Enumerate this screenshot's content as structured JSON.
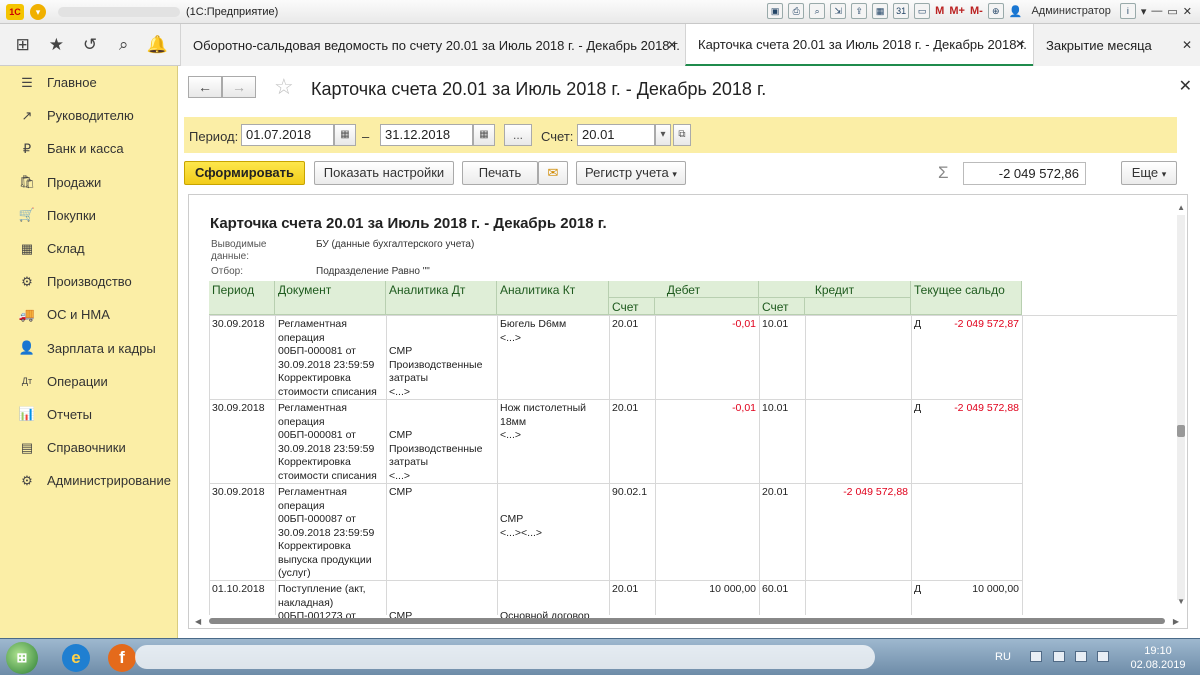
{
  "titlebar": {
    "logo": "1С",
    "title": "(1С:Предприятие)",
    "m1": "M",
    "m2": "M+",
    "m3": "M-",
    "calendar_day": "31",
    "user": "Администратор"
  },
  "tabs": [
    {
      "label": "Оборотно-сальдовая ведомость по счету 20.01 за Июль 2018 г. - Декабрь 2018 г."
    },
    {
      "label": "Карточка счета 20.01 за Июль 2018 г. - Декабрь 2018 г."
    },
    {
      "label": "Закрытие месяца"
    }
  ],
  "sidebar": {
    "items": [
      {
        "label": "Главное",
        "icon": "☰"
      },
      {
        "label": "Руководителю",
        "icon": "↗"
      },
      {
        "label": "Банк и касса",
        "icon": "₽"
      },
      {
        "label": "Продажи",
        "icon": "🛍"
      },
      {
        "label": "Покупки",
        "icon": "🛒"
      },
      {
        "label": "Склад",
        "icon": "▦"
      },
      {
        "label": "Производство",
        "icon": "⚙"
      },
      {
        "label": "ОС и НМА",
        "icon": "🚚"
      },
      {
        "label": "Зарплата и кадры",
        "icon": "👤"
      },
      {
        "label": "Операции",
        "icon": "Дт"
      },
      {
        "label": "Отчеты",
        "icon": "📊"
      },
      {
        "label": "Справочники",
        "icon": "▤"
      },
      {
        "label": "Администрирование",
        "icon": "⚙"
      }
    ]
  },
  "page": {
    "title": "Карточка счета 20.01 за Июль 2018 г. - Декабрь 2018 г."
  },
  "filters": {
    "period_label": "Период:",
    "date_from": "01.07.2018",
    "dash": "–",
    "date_to": "31.12.2018",
    "ellipsis": "...",
    "account_label": "Счет:",
    "account": "20.01"
  },
  "toolbar": {
    "generate": "Сформировать",
    "show_settings": "Показать настройки",
    "print": "Печать",
    "register": "Регистр учета",
    "sum": "-2 049 572,86",
    "more": "Еще"
  },
  "report": {
    "title": "Карточка счета 20.01 за Июль 2018 г. - Декабрь 2018 г.",
    "output_label": "Выводимые данные:",
    "output_value": "БУ (данные бухгалтерского учета)",
    "filter_label": "Отбор:",
    "filter_value": "Подразделение Равно \"\"",
    "headers": {
      "period": "Период",
      "document": "Документ",
      "analytics_dt": "Аналитика Дт",
      "analytics_kt": "Аналитика Кт",
      "debit": "Дебет",
      "credit": "Кредит",
      "balance": "Текущее сальдо",
      "account_dt": "Счет",
      "account_kt": "Счет"
    },
    "rows": [
      {
        "period": "30.09.2018",
        "document": "Регламентная\nоперация\n00БП-000081 от\n30.09.2018 23:59:59\nКорректировка\nстоимости списания",
        "analytics_dt": "\n\nСМР\nПроизводственные\nзатраты\n<...>",
        "analytics_kt": "Бюгель D6мм\n<...>",
        "account_dt": "20.01",
        "debit": "-0,01",
        "account_kt": "10.01",
        "credit": "",
        "balance_side": "Д",
        "balance": "-2 049 572,87"
      },
      {
        "period": "30.09.2018",
        "document": "Регламентная\nоперация\n00БП-000081 от\n30.09.2018 23:59:59\nКорректировка\nстоимости списания",
        "analytics_dt": "\n\nСМР\nПроизводственные\nзатраты\n<...>",
        "analytics_kt": "Нож пистолетный\n18мм\n<...>",
        "account_dt": "20.01",
        "debit": "-0,01",
        "account_kt": "10.01",
        "credit": "",
        "balance_side": "Д",
        "balance": "-2 049 572,88"
      },
      {
        "period": "30.09.2018",
        "document": "Регламентная\nоперация\n00БП-000087 от\n30.09.2018 23:59:59\nКорректировка\nвыпуска продукции\n(услуг)",
        "analytics_dt": "СМР",
        "analytics_kt": "\n\nСМР\n<...><...>",
        "account_dt": "90.02.1",
        "debit": "",
        "account_kt": "20.01",
        "credit": "-2 049 572,88",
        "balance_side": "",
        "balance": ""
      },
      {
        "period": "01.10.2018",
        "document": "Поступление (акт,\nнакладная)\n00БП-001273 от",
        "analytics_dt": "\n\nСМР",
        "analytics_kt": "\n\nОсновной договор",
        "account_dt": "20.01",
        "debit": "10 000,00",
        "account_kt": "60.01",
        "credit": "",
        "balance_side": "Д",
        "balance": "10 000,00"
      }
    ]
  },
  "taskbar": {
    "lang": "RU",
    "time": "19:10",
    "date": "02.08.2019"
  }
}
